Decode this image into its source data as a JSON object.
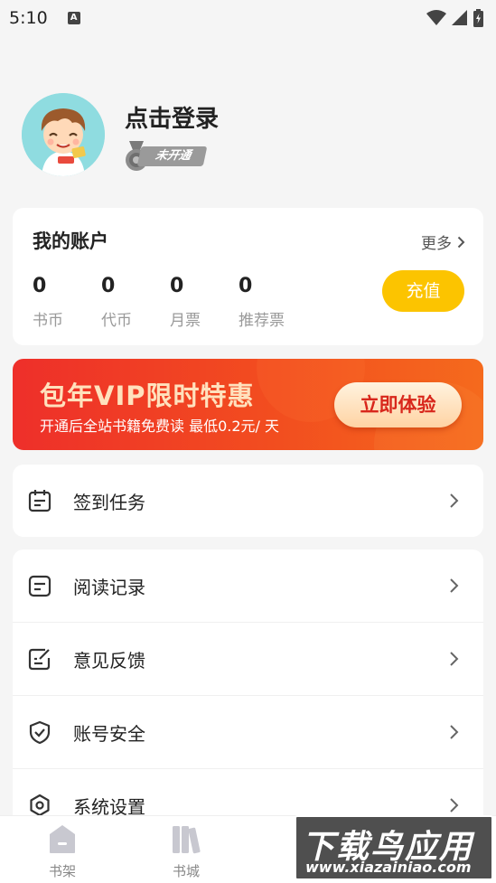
{
  "status_bar": {
    "time": "5:10",
    "notification_icon": "A"
  },
  "profile": {
    "login_text": "点击登录",
    "vip_status": "未开通"
  },
  "account": {
    "title": "我的账户",
    "more_label": "更多",
    "stats": [
      {
        "value": "0",
        "label": "书币"
      },
      {
        "value": "0",
        "label": "代币"
      },
      {
        "value": "0",
        "label": "月票"
      },
      {
        "value": "0",
        "label": "推荐票"
      }
    ],
    "recharge_label": "充值"
  },
  "vip_banner": {
    "title": "包年VIP限时特惠",
    "subtitle": "开通后全站书籍免费读 最低0.2元/ 天",
    "button_label": "立即体验"
  },
  "menu": {
    "checkin": "签到任务",
    "reading_history": "阅读记录",
    "feedback": "意见反馈",
    "account_security": "账号安全",
    "settings": "系统设置"
  },
  "tabs": [
    {
      "label": "书架",
      "icon": "bookshelf-icon"
    },
    {
      "label": "书城",
      "icon": "bookstore-icon"
    }
  ],
  "watermark": {
    "main": "下载鸟应用",
    "url": "www.xiazainiao.com"
  },
  "colors": {
    "accent": "#fcc400",
    "banner_red": "#ee2f2a",
    "banner_button_text": "#d8271c"
  }
}
